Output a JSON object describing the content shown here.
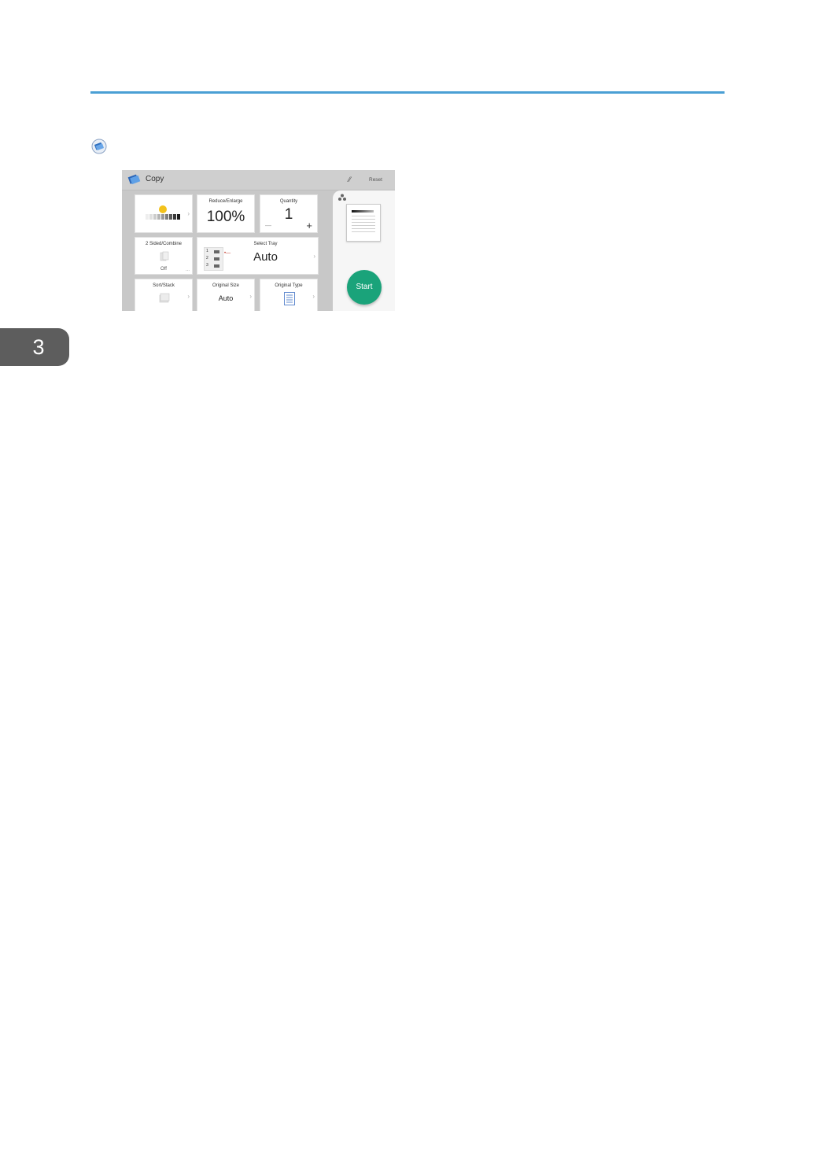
{
  "chapter": {
    "number": "3"
  },
  "note": {
    "icon": "note-icon"
  },
  "colors": {
    "rule": "#4a9fd4",
    "chapter_tab": "#5d5d5d",
    "start": "#1aa37a"
  },
  "screen": {
    "app_title": "Copy",
    "reset_label": "Reset",
    "tiles": {
      "density": {
        "label": ""
      },
      "reduce_enlarge": {
        "label": "Reduce/Enlarge",
        "value": "100%"
      },
      "quantity": {
        "label": "Quantity",
        "value": "1",
        "minus": "—",
        "plus": "+"
      },
      "two_sided": {
        "label": "2 Sided/Combine",
        "value": "Off",
        "more": "..."
      },
      "select_tray": {
        "label": "Select Tray",
        "value": "Auto",
        "tray_numbers": [
          "1",
          "2",
          "3"
        ]
      },
      "sort_stack": {
        "label": "Sort/Stack"
      },
      "original_size": {
        "label": "Original Size",
        "value": "Auto"
      },
      "original_type": {
        "label": "Original Type"
      }
    },
    "start_label": "Start"
  }
}
